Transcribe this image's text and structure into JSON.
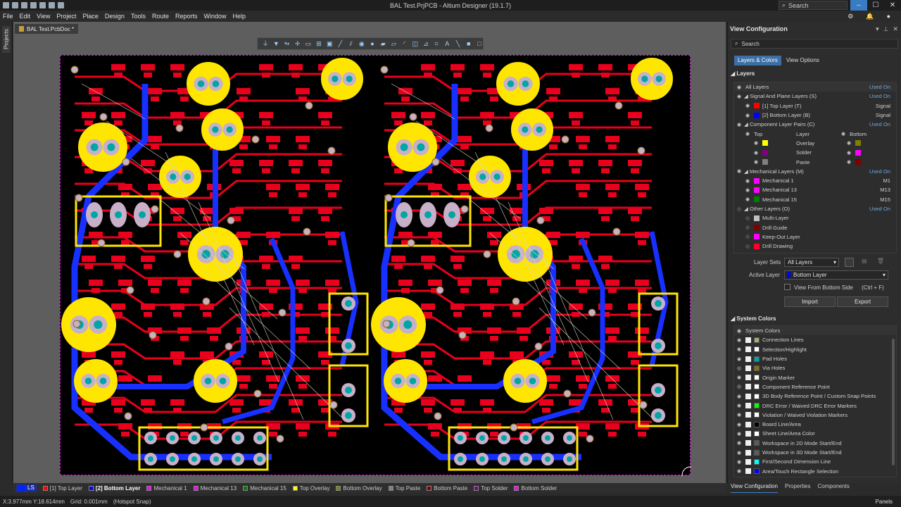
{
  "app": {
    "title": "BAL Test.PrjPCB - Altium Designer (19.1.7)",
    "search_placeholder": "Search"
  },
  "menu": [
    "File",
    "Edit",
    "View",
    "Project",
    "Place",
    "Design",
    "Tools",
    "Route",
    "Reports",
    "Window",
    "Help"
  ],
  "left_strip": {
    "projects_tab": "Projects"
  },
  "document": {
    "tab_label": "BAL Test.PcbDoc *"
  },
  "layer_tabs": [
    {
      "label": "LS",
      "color": "#0024ff"
    },
    {
      "label": "[1] Top Layer",
      "color": "#ff0000"
    },
    {
      "label": "[2] Bottom Layer",
      "color": "#0000ff",
      "active": true
    },
    {
      "label": "Mechanical 1",
      "color": "#ff00ff"
    },
    {
      "label": "Mechanical 13",
      "color": "#ff00ff"
    },
    {
      "label": "Mechanical 15",
      "color": "#008000"
    },
    {
      "label": "Top Overlay",
      "color": "#ffff00"
    },
    {
      "label": "Bottom Overlay",
      "color": "#808000"
    },
    {
      "label": "Top Paste",
      "color": "#808080"
    },
    {
      "label": "Bottom Paste",
      "color": "#800000"
    },
    {
      "label": "Top Solder",
      "color": "#800080"
    },
    {
      "label": "Bottom Solder",
      "color": "#ff00ff"
    }
  ],
  "status": {
    "coords": "X:3.977mm Y:18.614mm",
    "grid": "Grid: 0.001mm",
    "snap": "(Hotspot Snap)",
    "panels": "Panels"
  },
  "panel": {
    "title": "View Configuration",
    "search_placeholder": "Search",
    "tabs": [
      "Layers & Colors",
      "View Options"
    ],
    "layers_title": "Layers",
    "layers": {
      "all_layers": {
        "label": "All Layers",
        "right": "Used On"
      },
      "signal_group": {
        "label": "Signal And Plane Layers (S)",
        "right": "Used On"
      },
      "signal": [
        {
          "label": "[1] Top Layer (T)",
          "right": "Signal",
          "color": "#ff0000"
        },
        {
          "label": "[2] Bottom Layer (B)",
          "right": "Signal",
          "color": "#0000ff"
        }
      ],
      "pairs_group": {
        "label": "Component Layer Pairs (C)",
        "right": "Used On"
      },
      "pairs_header": {
        "top": "Top",
        "layer": "Layer",
        "bottom": "Bottom"
      },
      "pairs": [
        {
          "label": "Overlay",
          "top_color": "#ffff00",
          "bottom_color": "#808000"
        },
        {
          "label": "Solder",
          "top_color": "#800080",
          "bottom_color": "#ff00ff"
        },
        {
          "label": "Paste",
          "top_color": "#808080",
          "bottom_color": "#800000"
        }
      ],
      "mech_group": {
        "label": "Mechanical Layers (M)",
        "right": "Used On"
      },
      "mech": [
        {
          "label": "Mechanical 1",
          "right": "M1",
          "color": "#ff00ff"
        },
        {
          "label": "Mechanical 13",
          "right": "M13",
          "color": "#ff00ff"
        },
        {
          "label": "Mechanical 15",
          "right": "M15",
          "color": "#008000"
        }
      ],
      "other_group": {
        "label": "Other Layers (O)",
        "right": "Used On"
      },
      "other": [
        {
          "label": "Multi-Layer",
          "color": "#c0c0c0"
        },
        {
          "label": "Drill Guide",
          "color": "#800000"
        },
        {
          "label": "Keep-Out Layer",
          "color": "#ff00ff"
        },
        {
          "label": "Drill Drawing",
          "color": "#ff002a"
        }
      ]
    },
    "layer_sets_label": "Layer Sets",
    "layer_sets_value": "All Layers",
    "active_layer_label": "Active Layer",
    "active_layer_value": "Bottom Layer",
    "view_from_bottom": "View From Bottom Side",
    "view_from_bottom_shortcut": "(Ctrl + F)",
    "import_label": "Import",
    "export_label": "Export",
    "system_colors_title": "System Colors",
    "system_colors_header": "System Colors",
    "system_colors": [
      {
        "label": "Connection Lines",
        "color": "#a8a878"
      },
      {
        "label": "Selection/Highlight",
        "color": "#ffffff"
      },
      {
        "label": "Pad Holes",
        "color": "#00a6a6"
      },
      {
        "label": "Via Holes",
        "color": "#8a6c18"
      },
      {
        "label": "Origin Marker",
        "color": "#ffffff"
      },
      {
        "label": "Component Reference Point",
        "color": "#ffffff"
      },
      {
        "label": "3D Body Reference Point / Custom Snap Points",
        "color": "#ffffff"
      },
      {
        "label": "DRC Error / Waived DRC Error Markers",
        "color": "#00ff00"
      },
      {
        "label": "Violation / Waived Violation Markers",
        "color": "#ffffff"
      },
      {
        "label": "Board Line/Area",
        "color": "#000000"
      },
      {
        "label": "Sheet Line/Area Color",
        "color": "#ffffff"
      },
      {
        "label": "Workspace in 2D Mode Start/End",
        "color": "#5a5a5a"
      },
      {
        "label": "Workspace in 3D Mode Start/End",
        "color": "#5a5a5a"
      },
      {
        "label": "First/Second Dimension Line",
        "color": "#00ffff"
      },
      {
        "label": "Area/Touch Rectangle Selection",
        "color": "#0000ff"
      }
    ],
    "bottom_tabs": [
      "View Configuration",
      "Properties",
      "Components"
    ]
  }
}
